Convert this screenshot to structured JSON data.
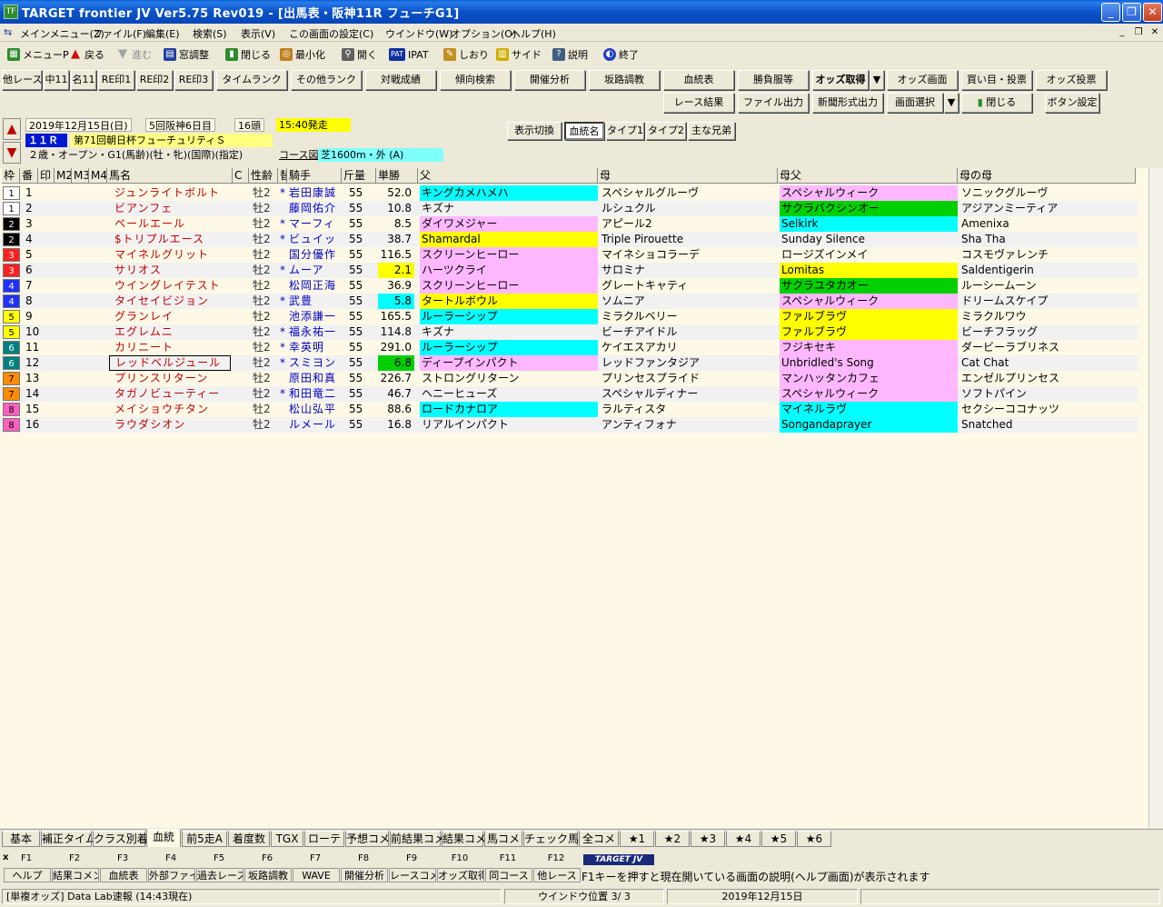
{
  "window": {
    "title": "TARGET frontier JV  Ver5.75  Rev019 - [出馬表・阪神11R フューチG1]",
    "app_icon": "TF"
  },
  "menu": [
    "メインメニュー(Z)",
    "ファイル(F)",
    "編集(E)",
    "検索(S)",
    "表示(V)",
    "この画面の設定(C)",
    "ウインドウ(W)",
    "オプション(O)",
    "ヘルプ(H)"
  ],
  "toolbar": [
    {
      "label": "メニューP",
      "icon": "menu-icon",
      "color": "#2e8b2e"
    },
    {
      "label": "戻る",
      "icon": "back-arrow-icon",
      "color": "#d01010"
    },
    {
      "label": "進む",
      "icon": "forward-arrow-icon",
      "color": "#a0a0a0"
    },
    {
      "label": "窓調整",
      "icon": "window-icon",
      "color": "#2040a0"
    },
    {
      "label": "閉じる",
      "icon": "door-icon",
      "color": "#2e8b2e"
    },
    {
      "label": "最小化",
      "icon": "minimize-icon",
      "color": "#c08020"
    },
    {
      "label": "開く",
      "icon": "open-icon",
      "color": "#606060"
    },
    {
      "label": "IPAT",
      "icon": "pat-icon",
      "color": "#1030a0"
    },
    {
      "label": "しおり",
      "icon": "bookmark-icon",
      "color": "#c09020"
    },
    {
      "label": "サイド",
      "icon": "side-icon",
      "color": "#d0b000"
    },
    {
      "label": "説明",
      "icon": "help-icon",
      "color": "#406080"
    },
    {
      "label": "終了",
      "icon": "exit-icon",
      "color": "#2040c0"
    }
  ],
  "buttons_row1": [
    "他レース",
    "中11",
    "名11",
    "RE印1",
    "RE印2",
    "RE印3",
    "タイムランク",
    "その他ランク",
    "対戦成績",
    "傾向検索",
    "開催分析",
    "坂路調教",
    "血統表",
    "勝負服等",
    "オッズ取得",
    "オッズ画面",
    "買い目・投票",
    "オッズ投票"
  ],
  "buttons_row2": [
    "レース結果",
    "ファイル出力",
    "新聞形式出力",
    "画面選択",
    "閉じる",
    "ボタン設定"
  ],
  "race": {
    "date": "2019年12月15日(日)",
    "meeting": "5回阪神6日目",
    "heads": "16頭",
    "start": "15:40発走",
    "race_no": "１１Ｒ",
    "name": "第71回朝日杯フューチュリティＳ",
    "conditions": "２歳・オープン・G1(馬齢)(牡・牝)(国際)(指定)",
    "course_label": "コース図",
    "course": "芝1600m・外 (A)"
  },
  "view_buttons": [
    "表示切換",
    "血統名",
    "タイプ1",
    "タイプ2",
    "主な兄弟"
  ],
  "headers": [
    "枠",
    "番",
    "印",
    "M2",
    "M3",
    "M4",
    "馬名",
    "C",
    "性齢",
    "替",
    "騎手",
    "斤量",
    "単勝",
    "父",
    "母",
    "母父",
    "母の母"
  ],
  "waku_colors": {
    "1": [
      "#ffffff",
      "#000000"
    ],
    "2": [
      "#000000",
      "#ffffff"
    ],
    "3": [
      "#ff2020",
      "#ffffff"
    ],
    "4": [
      "#2030ff",
      "#ffffff"
    ],
    "5": [
      "#ffff00",
      "#000000"
    ],
    "6": [
      "#008080",
      "#ffffff"
    ],
    "7": [
      "#ff8c00",
      "#000000"
    ],
    "8": [
      "#ff60c0",
      "#000000"
    ]
  },
  "rows": [
    {
      "waku": "1",
      "num": "1",
      "name": "ジュンライトボルト",
      "sex": "牡2",
      "change": "*",
      "jockey": "岩田康誠",
      "weight": "55",
      "odds": "52.0",
      "odds_bg": "",
      "sire": "キングカメハメハ",
      "sire_bg": "#00ffff",
      "dam": "スペシャルグルーヴ",
      "dam_bg": "",
      "bms": "スペシャルウィーク",
      "bms_bg": "#ffb8ff",
      "damdam": "ソニックグルーヴ",
      "damdam_bg": ""
    },
    {
      "waku": "1",
      "num": "2",
      "name": "ビアンフェ",
      "sex": "牡2",
      "change": "",
      "jockey": "藤岡佑介",
      "weight": "55",
      "odds": "10.8",
      "odds_bg": "",
      "sire": "キズナ",
      "sire_bg": "",
      "dam": "ルシュクル",
      "dam_bg": "",
      "bms": "サクラバクシンオー",
      "bms_bg": "#00d000",
      "damdam": "アジアンミーティア",
      "damdam_bg": ""
    },
    {
      "waku": "2",
      "num": "3",
      "name": "ペールエール",
      "sex": "牡2",
      "change": "*",
      "jockey": "マーフィ",
      "weight": "55",
      "odds": "8.5",
      "odds_bg": "",
      "sire": "ダイワメジャー",
      "sire_bg": "#ffb8ff",
      "dam": "アピール2",
      "dam_bg": "",
      "bms": "Selkirk",
      "bms_bg": "#00ffff",
      "damdam": "Amenixa",
      "damdam_bg": ""
    },
    {
      "waku": "2",
      "num": "4",
      "name": "$トリプルエース",
      "sex": "牡2",
      "change": "*",
      "jockey": "ビュイッ",
      "weight": "55",
      "odds": "38.7",
      "odds_bg": "",
      "sire": "Shamardal",
      "sire_bg": "#ffff00",
      "dam": "Triple Pirouette",
      "dam_bg": "",
      "bms": "Sunday Silence",
      "bms_bg": "",
      "damdam": "Sha Tha",
      "damdam_bg": ""
    },
    {
      "waku": "3",
      "num": "5",
      "name": "マイネルグリット",
      "sex": "牡2",
      "change": "",
      "jockey": "国分優作",
      "weight": "55",
      "odds": "116.5",
      "odds_bg": "",
      "sire": "スクリーンヒーロー",
      "sire_bg": "#ffb8ff",
      "dam": "マイネショコラーデ",
      "dam_bg": "",
      "bms": "ロージズインメイ",
      "bms_bg": "",
      "damdam": "コスモヴァレンチ",
      "damdam_bg": ""
    },
    {
      "waku": "3",
      "num": "6",
      "name": "サリオス",
      "sex": "牡2",
      "change": "*",
      "jockey": "ムーア",
      "weight": "55",
      "odds": "2.1",
      "odds_bg": "#ffff00",
      "sire": "ハーツクライ",
      "sire_bg": "#ffb8ff",
      "dam": "サロミナ",
      "dam_bg": "",
      "bms": "Lomitas",
      "bms_bg": "#ffff00",
      "damdam": "Saldentigerin",
      "damdam_bg": ""
    },
    {
      "waku": "4",
      "num": "7",
      "name": "ウイングレイテスト",
      "sex": "牡2",
      "change": "",
      "jockey": "松岡正海",
      "weight": "55",
      "odds": "36.9",
      "odds_bg": "",
      "sire": "スクリーンヒーロー",
      "sire_bg": "#ffb8ff",
      "dam": "グレートキャティ",
      "dam_bg": "",
      "bms": "サクラユタカオー",
      "bms_bg": "#00d000",
      "damdam": "ルーシームーン",
      "damdam_bg": ""
    },
    {
      "waku": "4",
      "num": "8",
      "name": "タイセイビジョン",
      "sex": "牡2",
      "change": "*",
      "jockey": "武豊",
      "weight": "55",
      "odds": "5.8",
      "odds_bg": "#00ffff",
      "sire": "タートルボウル",
      "sire_bg": "#ffff00",
      "dam": "ソムニア",
      "dam_bg": "",
      "bms": "スペシャルウィーク",
      "bms_bg": "#ffb8ff",
      "damdam": "ドリームスケイプ",
      "damdam_bg": ""
    },
    {
      "waku": "5",
      "num": "9",
      "name": "グランレイ",
      "sex": "牡2",
      "change": "",
      "jockey": "池添謙一",
      "weight": "55",
      "odds": "165.5",
      "odds_bg": "",
      "sire": "ルーラーシップ",
      "sire_bg": "#00ffff",
      "dam": "ミラクルベリー",
      "dam_bg": "",
      "bms": "ファルブラヴ",
      "bms_bg": "#ffff00",
      "damdam": "ミラクルワウ",
      "damdam_bg": ""
    },
    {
      "waku": "5",
      "num": "10",
      "name": "エグレムニ",
      "sex": "牡2",
      "change": "*",
      "jockey": "福永祐一",
      "weight": "55",
      "odds": "114.8",
      "odds_bg": "",
      "sire": "キズナ",
      "sire_bg": "",
      "dam": "ビーチアイドル",
      "dam_bg": "",
      "bms": "ファルブラヴ",
      "bms_bg": "#ffff00",
      "damdam": "ビーチフラッグ",
      "damdam_bg": ""
    },
    {
      "waku": "6",
      "num": "11",
      "name": "カリニート",
      "sex": "牡2",
      "change": "*",
      "jockey": "幸英明",
      "weight": "55",
      "odds": "291.0",
      "odds_bg": "",
      "sire": "ルーラーシップ",
      "sire_bg": "#00ffff",
      "dam": "ケイエスアカリ",
      "dam_bg": "",
      "bms": "フジキセキ",
      "bms_bg": "#ffb8ff",
      "damdam": "ダービーラブリネス",
      "damdam_bg": ""
    },
    {
      "waku": "6",
      "num": "12",
      "name": "レッドベルジュール",
      "sex": "牡2",
      "change": "*",
      "jockey": "スミヨン",
      "weight": "55",
      "odds": "6.8",
      "odds_bg": "#00d000",
      "sire": "ディープインパクト",
      "sire_bg": "#ffb8ff",
      "dam": "レッドファンタジア",
      "dam_bg": "",
      "bms": "Unbridled's Song",
      "bms_bg": "#ffb8ff",
      "damdam": "Cat Chat",
      "damdam_bg": "",
      "selected": true
    },
    {
      "waku": "7",
      "num": "13",
      "name": "プリンスリターン",
      "sex": "牡2",
      "change": "",
      "jockey": "原田和真",
      "weight": "55",
      "odds": "226.7",
      "odds_bg": "",
      "sire": "ストロングリターン",
      "sire_bg": "",
      "dam": "プリンセスプライド",
      "dam_bg": "",
      "bms": "マンハッタンカフェ",
      "bms_bg": "#ffb8ff",
      "damdam": "エンゼルプリンセス",
      "damdam_bg": ""
    },
    {
      "waku": "7",
      "num": "14",
      "name": "タガノビューティー",
      "sex": "牡2",
      "change": "*",
      "jockey": "和田竜二",
      "weight": "55",
      "odds": "46.7",
      "odds_bg": "",
      "sire": "ヘニーヒューズ",
      "sire_bg": "",
      "dam": "スペシャルディナー",
      "dam_bg": "",
      "bms": "スペシャルウィーク",
      "bms_bg": "#ffb8ff",
      "damdam": "ソフトパイン",
      "damdam_bg": ""
    },
    {
      "waku": "8",
      "num": "15",
      "name": "メイショウチタン",
      "sex": "牡2",
      "change": "",
      "jockey": "松山弘平",
      "weight": "55",
      "odds": "88.6",
      "odds_bg": "",
      "sire": "ロードカナロア",
      "sire_bg": "#00ffff",
      "dam": "ラルティスタ",
      "dam_bg": "",
      "bms": "マイネルラヴ",
      "bms_bg": "#00ffff",
      "damdam": "セクシーココナッツ",
      "damdam_bg": ""
    },
    {
      "waku": "8",
      "num": "16",
      "name": "ラウダシオン",
      "sex": "牡2",
      "change": "",
      "jockey": "ルメール",
      "weight": "55",
      "odds": "16.8",
      "odds_bg": "",
      "sire": "リアルインパクト",
      "sire_bg": "",
      "dam": "アンティフォナ",
      "dam_bg": "",
      "bms": "Songandaprayer",
      "bms_bg": "#00ffff",
      "damdam": "Snatched",
      "damdam_bg": ""
    }
  ],
  "tabs": [
    "基本",
    "補正タイム",
    "クラス別着",
    "血統",
    "前5走A",
    "着度数",
    "TGX",
    "ローテ",
    "予想コメ",
    "前結果コメ",
    "結果コメ",
    "馬コメ",
    "チェック馬コメ",
    "全コメ",
    "★1",
    "★2",
    "★3",
    "★4",
    "★5",
    "★6"
  ],
  "active_tab": "血統",
  "fkeys": [
    {
      "key": "F1",
      "label": "ヘルプ"
    },
    {
      "key": "F2",
      "label": "結果コメント"
    },
    {
      "key": "F3",
      "label": "血統表"
    },
    {
      "key": "F4",
      "label": "外部ファイル"
    },
    {
      "key": "F5",
      "label": "過去レース"
    },
    {
      "key": "F6",
      "label": "坂路調教"
    },
    {
      "key": "F7",
      "label": "WAVE"
    },
    {
      "key": "F8",
      "label": "開催分析"
    },
    {
      "key": "F9",
      "label": "レースコメント"
    },
    {
      "key": "F10",
      "label": "オッズ取得"
    },
    {
      "key": "F11",
      "label": "同コース"
    },
    {
      "key": "F12",
      "label": "他レース"
    }
  ],
  "fkey_logo": "TARGET JV",
  "fkey_help": "F1キーを押すと現在開いている画面の説明(ヘルプ画面)が表示されます",
  "status": {
    "odds": "[単複オッズ] Data Lab速報 (14:43現在)",
    "window_pos": "ウインドウ位置 3/ 3",
    "date": "2019年12月15日"
  }
}
